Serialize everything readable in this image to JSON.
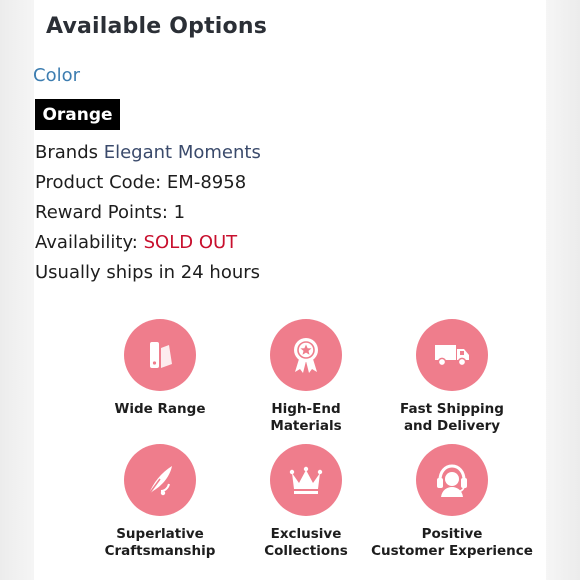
{
  "section": {
    "title": "Available Options"
  },
  "options": {
    "color_label": "Color",
    "selected_color": "Orange"
  },
  "product_info": {
    "brand_label": "Brands",
    "brand_value": "Elegant Moments",
    "product_code": "Product Code: EM-8958",
    "reward_points": "Reward Points: 1",
    "availability_label": "Availability:",
    "availability_value": "SOLD OUT",
    "shipping_note": "Usually ships in 24 hours"
  },
  "features": [
    {
      "icon": "color-swatch-icon",
      "label": "Wide Range"
    },
    {
      "icon": "award-rosette-icon",
      "label": "High-End\nMaterials"
    },
    {
      "icon": "delivery-truck-icon",
      "label": "Fast Shipping\nand Delivery"
    },
    {
      "icon": "quill-pen-icon",
      "label": "Superlative\nCraftsmanship"
    },
    {
      "icon": "crown-icon",
      "label": "Exclusive\nCollections"
    },
    {
      "icon": "headset-agent-icon",
      "label": "Positive\nCustomer Experience"
    }
  ],
  "colors": {
    "accent_pink": "#ef7d8c",
    "link_blue": "#3d7db0",
    "brand_navy": "#3a4a6b",
    "sold_out_red": "#c8102e",
    "chip_black": "#000000"
  }
}
